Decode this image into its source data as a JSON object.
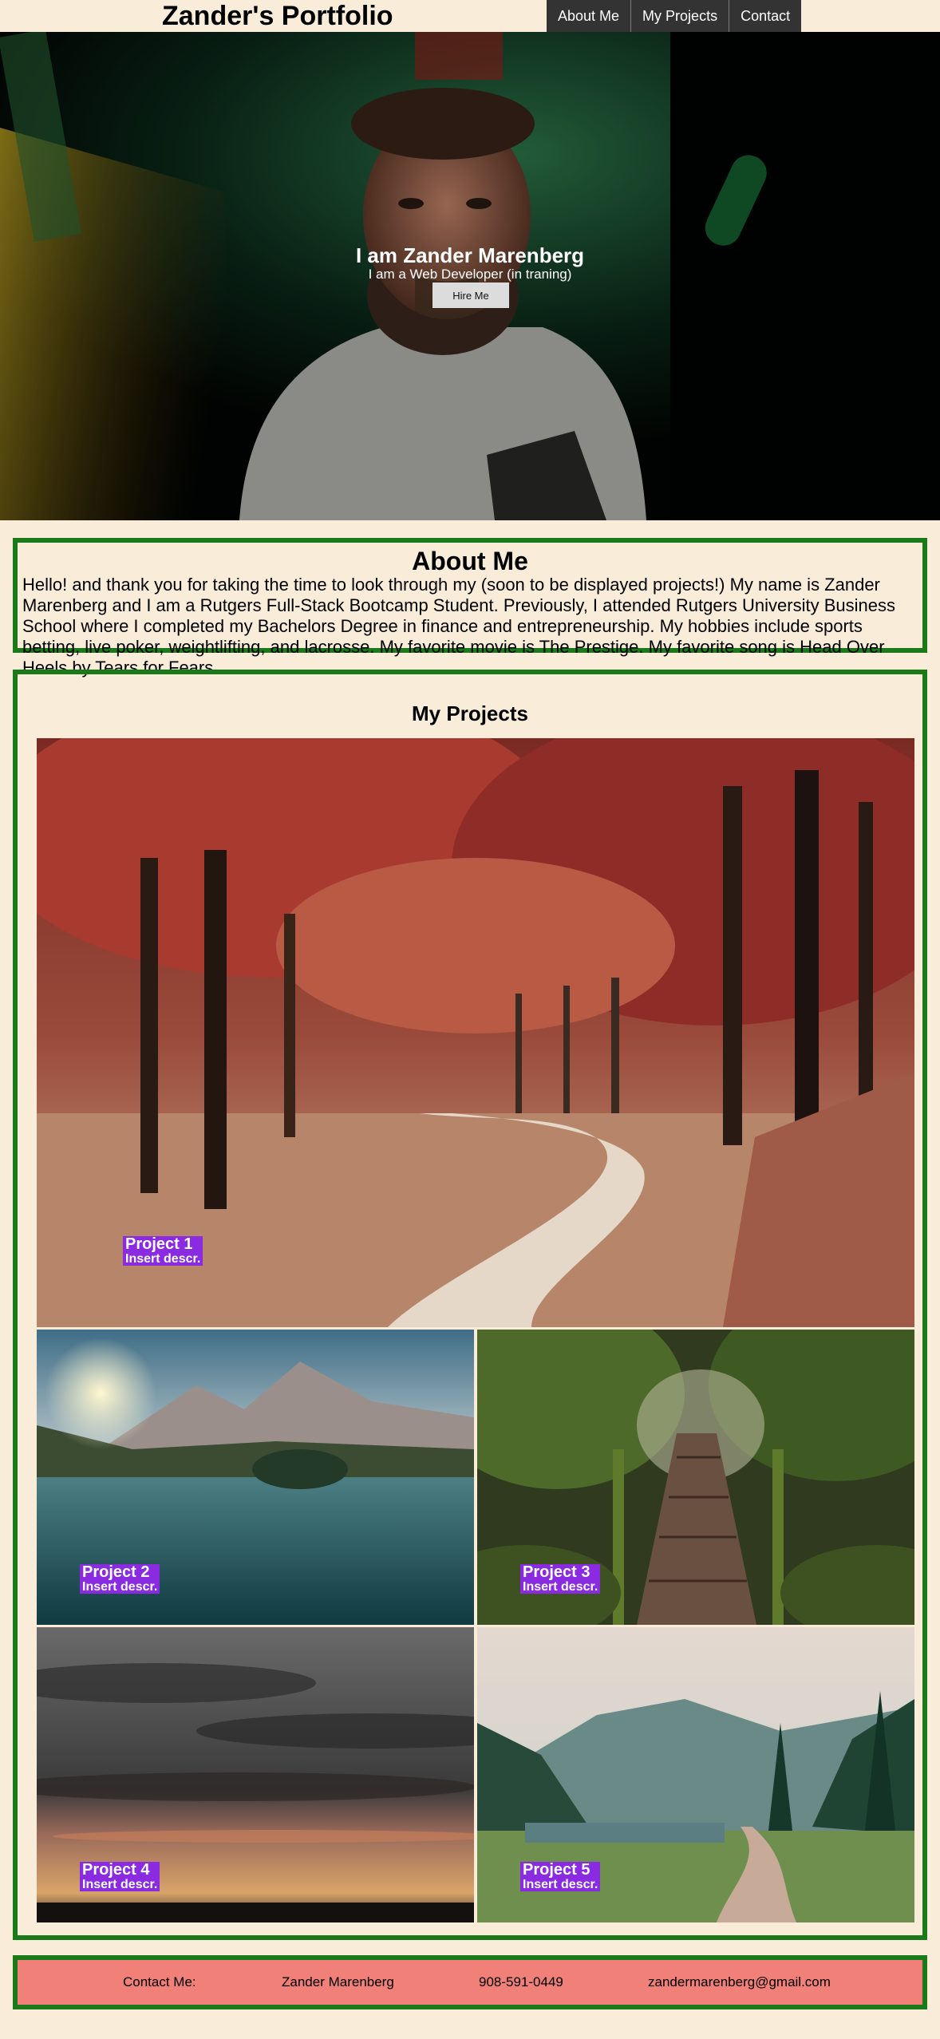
{
  "header": {
    "title": "Zander's Portfolio",
    "nav": [
      {
        "label": "About Me"
      },
      {
        "label": "My Projects"
      },
      {
        "label": "Contact"
      }
    ]
  },
  "hero": {
    "heading": "I am Zander Marenberg",
    "subheading": "I am a Web Developer (in traning)",
    "button": "Hire Me"
  },
  "about": {
    "heading": "About Me",
    "body": "Hello! and thank you for taking the time to look through my (soon to be displayed projects!) My name is Zander Marenberg and I am a Rutgers Full-Stack Bootcamp Student. Previously, I attended Rutgers University Business School where I completed my Bachelors Degree in finance and entrepreneurship. My hobbies include sports betting, live poker, weightlifting, and lacrosse. My favorite movie is The Prestige. My favorite song is Head Over Heels by Tears for Fears."
  },
  "projects": {
    "heading": "My Projects",
    "items": [
      {
        "title": "Project 1",
        "desc": "Insert descr."
      },
      {
        "title": "Project 2",
        "desc": "Insert descr."
      },
      {
        "title": "Project 3",
        "desc": "Insert descr."
      },
      {
        "title": "Project 4",
        "desc": "Insert descr."
      },
      {
        "title": "Project 5",
        "desc": "Insert descr."
      }
    ]
  },
  "contact": {
    "label": "Contact Me:",
    "name": "Zander Marenberg",
    "phone": "908-591-0449",
    "email": "zandermarenberg@gmail.com"
  },
  "colors": {
    "background": "#f9ecd9",
    "nav_bg": "#333333",
    "border": "#1a7a1a",
    "label_bg": "#8a2be2",
    "contact_bg": "#f08078"
  }
}
